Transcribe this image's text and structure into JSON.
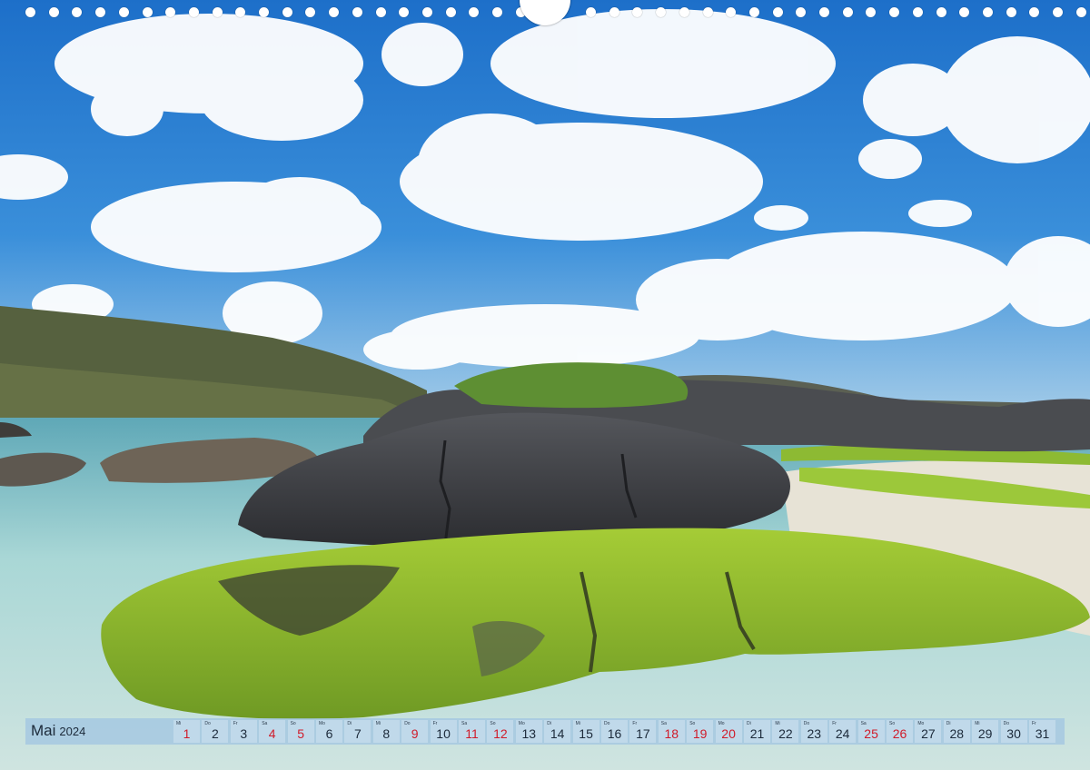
{
  "calendar": {
    "month": "Mai",
    "year": "2024",
    "weekend_color": "#d01b2a",
    "text_color": "#1c2a3a",
    "days": [
      {
        "num": "1",
        "abbr": "Mi",
        "red": true
      },
      {
        "num": "2",
        "abbr": "Do",
        "red": false
      },
      {
        "num": "3",
        "abbr": "Fr",
        "red": false
      },
      {
        "num": "4",
        "abbr": "Sa",
        "red": true
      },
      {
        "num": "5",
        "abbr": "So",
        "red": true
      },
      {
        "num": "6",
        "abbr": "Mo",
        "red": false
      },
      {
        "num": "7",
        "abbr": "Di",
        "red": false
      },
      {
        "num": "8",
        "abbr": "Mi",
        "red": false
      },
      {
        "num": "9",
        "abbr": "Do",
        "red": true
      },
      {
        "num": "10",
        "abbr": "Fr",
        "red": false
      },
      {
        "num": "11",
        "abbr": "Sa",
        "red": true
      },
      {
        "num": "12",
        "abbr": "So",
        "red": true
      },
      {
        "num": "13",
        "abbr": "Mo",
        "red": false
      },
      {
        "num": "14",
        "abbr": "Di",
        "red": false
      },
      {
        "num": "15",
        "abbr": "Mi",
        "red": false
      },
      {
        "num": "16",
        "abbr": "Do",
        "red": false
      },
      {
        "num": "17",
        "abbr": "Fr",
        "red": false
      },
      {
        "num": "18",
        "abbr": "Sa",
        "red": true
      },
      {
        "num": "19",
        "abbr": "So",
        "red": true
      },
      {
        "num": "20",
        "abbr": "Mo",
        "red": true
      },
      {
        "num": "21",
        "abbr": "Di",
        "red": false
      },
      {
        "num": "22",
        "abbr": "Mi",
        "red": false
      },
      {
        "num": "23",
        "abbr": "Do",
        "red": false
      },
      {
        "num": "24",
        "abbr": "Fr",
        "red": false
      },
      {
        "num": "25",
        "abbr": "Sa",
        "red": true
      },
      {
        "num": "26",
        "abbr": "So",
        "red": true
      },
      {
        "num": "27",
        "abbr": "Mo",
        "red": false
      },
      {
        "num": "28",
        "abbr": "Di",
        "red": false
      },
      {
        "num": "29",
        "abbr": "Mi",
        "red": false
      },
      {
        "num": "30",
        "abbr": "Do",
        "red": false
      },
      {
        "num": "31",
        "abbr": "Fr",
        "red": false
      }
    ]
  },
  "photo": {
    "sky_color": "#2f86d6",
    "cloud_color": "#ffffff",
    "hill_color": "#56613f",
    "rock_color": "#3d3f44",
    "moss_color": "#8fbf2e",
    "water_color": "#a9d7d6",
    "sand_color": "#e7e3d6"
  }
}
